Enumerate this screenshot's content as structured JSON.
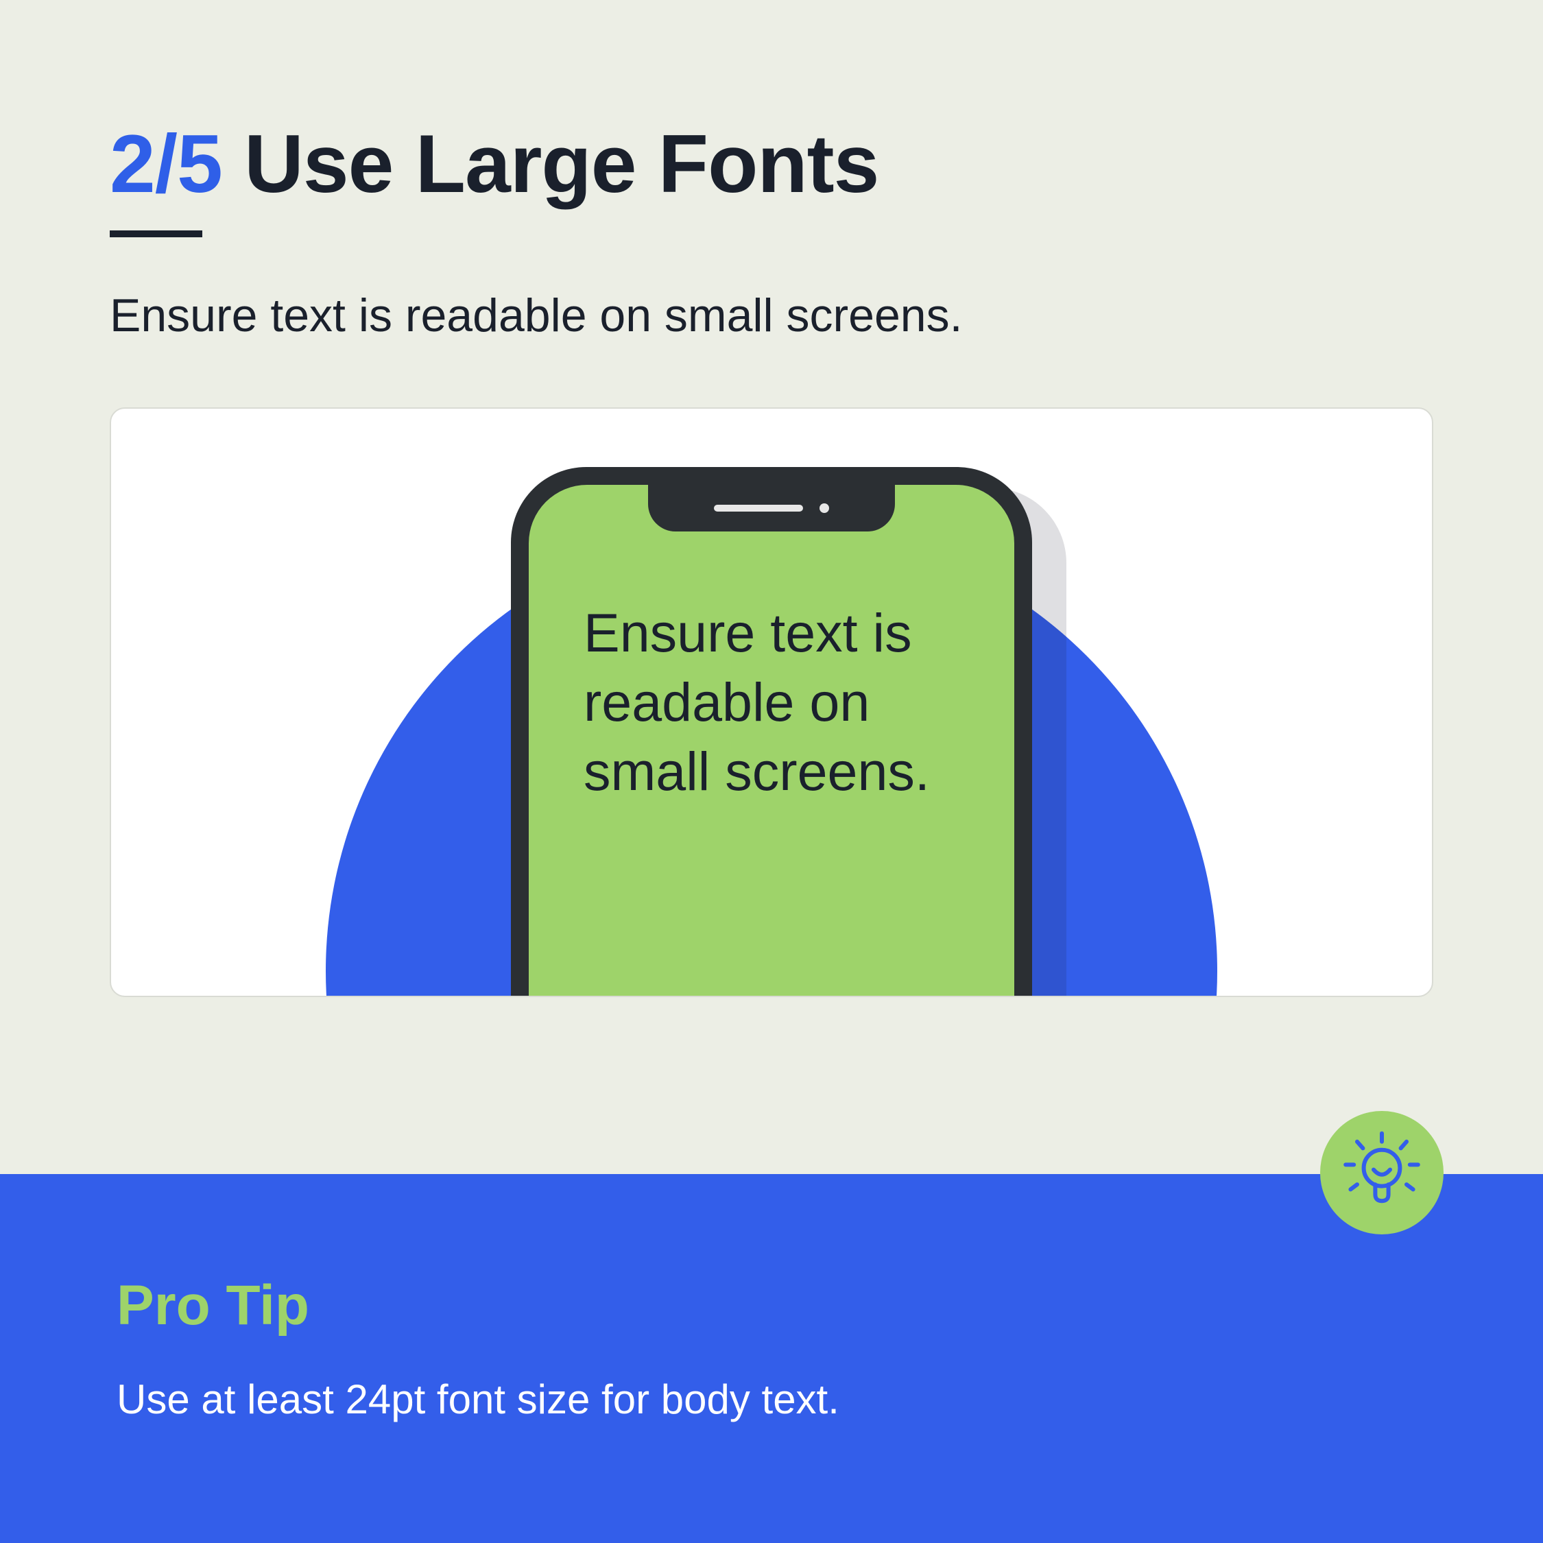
{
  "header": {
    "step_counter": "2/5",
    "title": "Use Large Fonts",
    "subtitle": "Ensure text is readable on small screens."
  },
  "illustration": {
    "phone_text": "Ensure text is readable on small screens."
  },
  "tip": {
    "label": "Pro Tip",
    "body": "Use at least 24pt font size for body text."
  },
  "colors": {
    "accent_blue": "#335eea",
    "accent_green": "#9ed36a",
    "background": "#eceee5",
    "text_dark": "#1a202c"
  }
}
